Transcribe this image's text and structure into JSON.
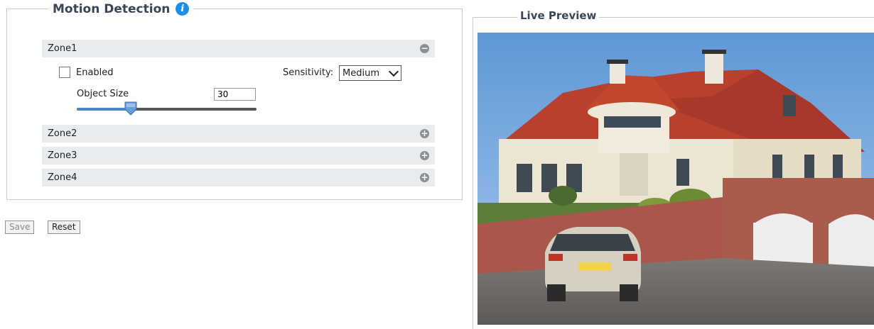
{
  "motion_detection": {
    "title": "Motion Detection",
    "info_icon": "info-icon",
    "zones": [
      {
        "label": "Zone1",
        "expanded": true,
        "toggle_icon": "minus-circle-icon"
      },
      {
        "label": "Zone2",
        "expanded": false,
        "toggle_icon": "plus-circle-icon"
      },
      {
        "label": "Zone3",
        "expanded": false,
        "toggle_icon": "plus-circle-icon"
      },
      {
        "label": "Zone4",
        "expanded": false,
        "toggle_icon": "plus-circle-icon"
      }
    ],
    "zone1": {
      "enabled_label": "Enabled",
      "enabled_checked": false,
      "sensitivity_label": "Sensitivity:",
      "sensitivity_value": "Medium",
      "object_size_label": "Object Size",
      "object_size_value": "30",
      "object_size_slider_fraction": 0.3
    }
  },
  "buttons": {
    "save_label": "Save",
    "reset_label": "Reset"
  },
  "live_preview": {
    "title": "Live Preview",
    "image_subject": "house-with-car-photo"
  },
  "colors": {
    "accent": "#1f8ee6",
    "zone_bar": "#e9ecef",
    "slider_handle": "#6a9ed6",
    "title_text": "#3a4657"
  }
}
